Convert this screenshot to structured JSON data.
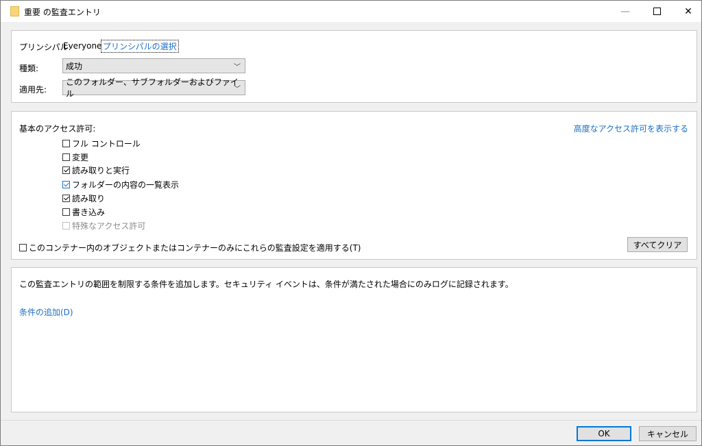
{
  "window": {
    "title": "重要 の監査エントリ"
  },
  "principal": {
    "label": "プリンシパル:",
    "value": "Everyone",
    "select_link": "プリンシパルの選択"
  },
  "type": {
    "label": "種類:",
    "value": "成功"
  },
  "applies_to": {
    "label": "適用先:",
    "value": "このフォルダー、サブフォルダーおよびファイル"
  },
  "permissions": {
    "header": "基本のアクセス許可:",
    "advanced_link": "高度なアクセス許可を表示する",
    "items": [
      {
        "label": "フル コントロール",
        "checked": false
      },
      {
        "label": "変更",
        "checked": false
      },
      {
        "label": "読み取りと実行",
        "checked": true
      },
      {
        "label": "フォルダーの内容の一覧表示",
        "checked": true
      },
      {
        "label": "読み取り",
        "checked": true
      },
      {
        "label": "書き込み",
        "checked": false
      },
      {
        "label": "特殊なアクセス許可",
        "checked": false,
        "disabled": true
      }
    ],
    "apply_container_only": "このコンテナー内のオブジェクトまたはコンテナーのみにこれらの監査設定を適用する(T)",
    "clear_all": "すべてクリア"
  },
  "conditions": {
    "description": "この監査エントリの範囲を制限する条件を追加します。セキュリティ イベントは、条件が満たされた場合にのみログに記録されます。",
    "add_link": "条件の追加(D)"
  },
  "footer": {
    "ok": "OK",
    "cancel": "キャンセル"
  },
  "colors": {
    "link": "#1a6fc9",
    "default_button_border": "#0078d7"
  }
}
